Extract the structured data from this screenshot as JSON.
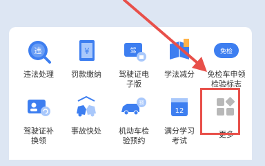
{
  "services": {
    "row1": [
      {
        "label": "违法处理",
        "icon": "traffic-violation-icon",
        "glyph": "违"
      },
      {
        "label": "罚款缴纳",
        "icon": "fine-payment-icon",
        "glyph": "¥"
      },
      {
        "label": "驾驶证电\n子版",
        "icon": "e-license-icon",
        "glyph": "驾"
      },
      {
        "label": "学法减分",
        "icon": "study-deduct-icon",
        "glyph": ""
      },
      {
        "label": "免检车申领\n检验标志",
        "icon": "inspection-exempt-icon",
        "glyph": "免检"
      }
    ],
    "row2": [
      {
        "label": "驾驶证补\n换领",
        "icon": "license-reissue-icon",
        "glyph": ""
      },
      {
        "label": "事故快处",
        "icon": "accident-icon",
        "glyph": ""
      },
      {
        "label": "机动车检\n验预约",
        "icon": "vehicle-inspection-icon",
        "glyph": "预"
      },
      {
        "label": "满分学习\n考试",
        "icon": "full-score-exam-icon",
        "glyph": "12"
      },
      {
        "label": "更多",
        "icon": "more-grid-icon",
        "glyph": ""
      }
    ]
  },
  "colors": {
    "primary": "#3d7ef0",
    "primary_light": "#a9c8fb",
    "highlight": "#e8504a"
  }
}
